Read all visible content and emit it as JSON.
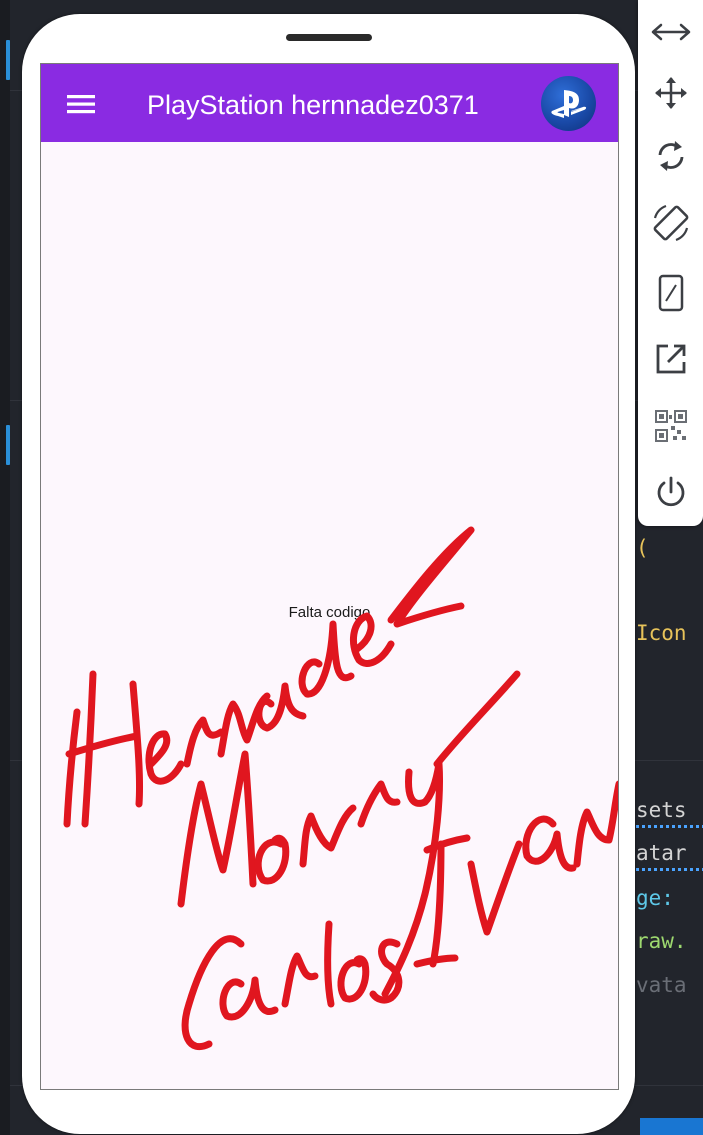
{
  "editor": {
    "code_fragments": [
      {
        "text": "(",
        "tone": "yellow"
      },
      {
        "text": "Icon",
        "tone": "yellow"
      },
      {
        "text": "sets",
        "tone": "white"
      },
      {
        "text": "atar",
        "tone": "white"
      },
      {
        "text": "ge:",
        "tone": "cyan"
      },
      {
        "text": "raw.",
        "tone": "green"
      },
      {
        "text": "vata",
        "tone": "dim"
      }
    ]
  },
  "toolbar": {
    "tools": [
      {
        "icon": "resize-horizontal-icon"
      },
      {
        "icon": "move-icon"
      },
      {
        "icon": "rotate-icon"
      },
      {
        "icon": "auto-rotate-icon"
      },
      {
        "icon": "device-frame-icon"
      },
      {
        "icon": "open-external-icon"
      },
      {
        "icon": "qr-code-icon"
      },
      {
        "icon": "power-icon"
      }
    ]
  },
  "app": {
    "title": "PlayStation hernnadez0371",
    "menu_icon": "hamburger-menu-icon",
    "avatar_icon": "playstation-logo-icon",
    "appbar_color": "#8a2be2",
    "body_text": "Falta codigo"
  },
  "annotation": {
    "handwritten_text": "Hernandez Monroy Carlos Ivan",
    "color": "#e0161f"
  }
}
